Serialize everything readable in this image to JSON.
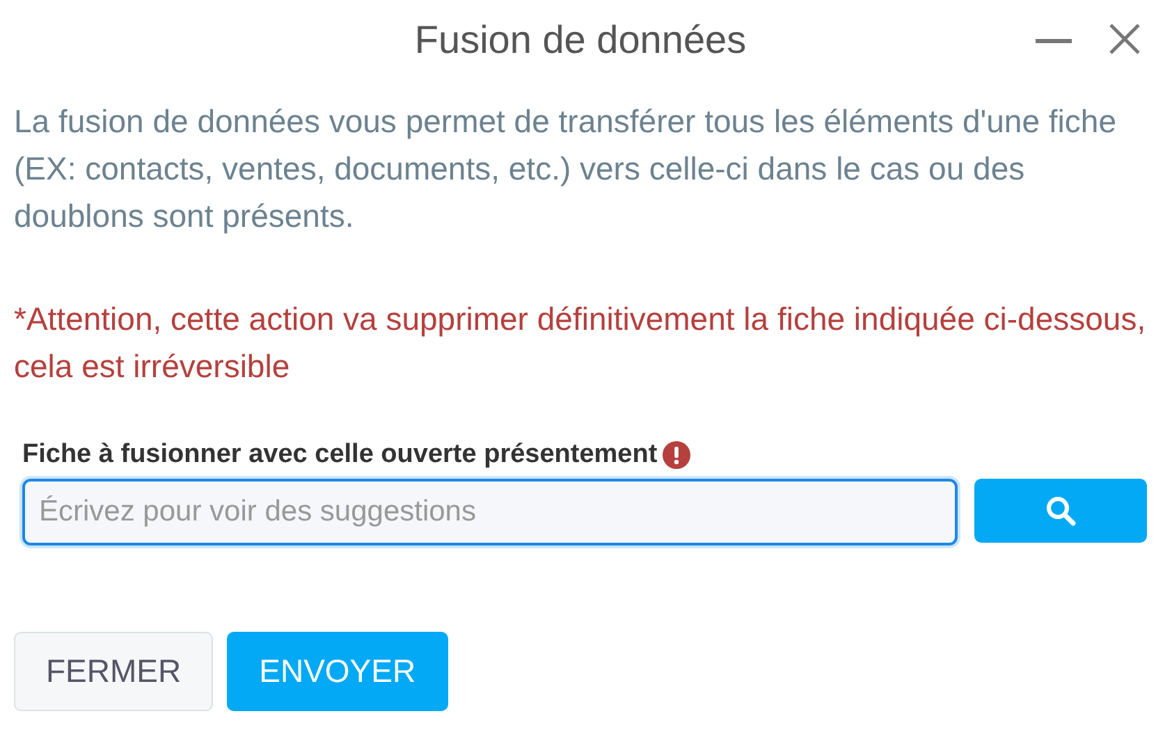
{
  "window": {
    "title": "Fusion de données"
  },
  "description": "La fusion de données vous permet de transférer tous les éléments d'une fiche (EX: contacts, ventes, documents, etc.) vers celle-ci dans le cas ou des doublons sont présents.",
  "warning": "*Attention, cette action va supprimer définitivement la fiche indiquée ci-dessous, cela est irréversible",
  "field": {
    "label": "Fiche à fusionner avec celle ouverte présentement",
    "placeholder": "Écrivez pour voir des suggestions",
    "focused": true
  },
  "buttons": [
    {
      "label": "FERMER",
      "kind": "secondary"
    },
    {
      "label": "ENVOYER",
      "kind": "primary"
    }
  ]
}
